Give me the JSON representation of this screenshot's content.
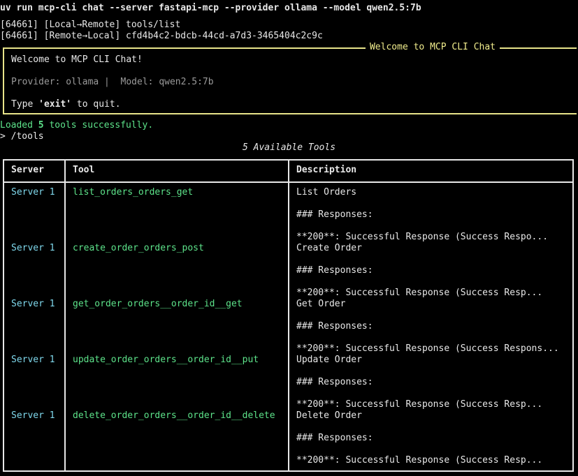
{
  "command": "uv run mcp-cli chat --server fastapi-mcp --provider ollama --model qwen2.5:7b",
  "log": [
    "[64661] [Local→Remote] tools/list",
    "[64661] [Remote→Local] cfd4b4c2-bdcb-44cd-a7d3-3465404c2c9c"
  ],
  "panel": {
    "title": "Welcome to MCP CLI Chat",
    "welcome": "Welcome to MCP CLI Chat!",
    "provider_line": "Provider: ollama |  Model: qwen2.5:7b",
    "quit_prefix": "Type ",
    "quit_cmd": "'exit'",
    "quit_suffix": " to quit."
  },
  "status": {
    "prefix": "Loaded ",
    "count": "5",
    "suffix": " tools successfully."
  },
  "prompt": "> /tools",
  "table": {
    "title": "5 Available Tools",
    "headers": [
      "Server",
      "Tool",
      "Description"
    ],
    "rows": [
      {
        "server": "Server 1",
        "tool": "list_orders_orders_get",
        "desc": [
          "List Orders",
          "",
          "### Responses:",
          "",
          "**200**: Successful Response (Success Respo..."
        ]
      },
      {
        "server": "Server 1",
        "tool": "create_order_orders_post",
        "desc": [
          "Create Order",
          "",
          "### Responses:",
          "",
          "**200**: Successful Response (Success Resp..."
        ]
      },
      {
        "server": "Server 1",
        "tool": "get_order_orders__order_id__get",
        "desc": [
          "Get Order",
          "",
          "### Responses:",
          "",
          "**200**: Successful Response (Success Respons..."
        ]
      },
      {
        "server": "Server 1",
        "tool": "update_order_orders__order_id__put",
        "desc": [
          "Update Order",
          "",
          "### Responses:",
          "",
          "**200**: Successful Response (Success Resp..."
        ]
      },
      {
        "server": "Server 1",
        "tool": "delete_order_orders__order_id__delete",
        "desc": [
          "Delete Order",
          "",
          "### Responses:",
          "",
          "**200**: Successful Response (Success Resp..."
        ]
      }
    ]
  },
  "colors": {
    "panel_border": "#e8e48a",
    "server": "#7fd8ec",
    "tool": "#5de38a",
    "success": "#5de38a"
  }
}
